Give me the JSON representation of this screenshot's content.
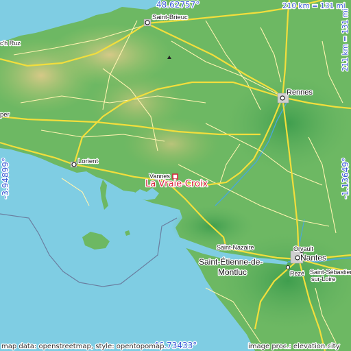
{
  "colors": {
    "sea": "#7fcde3",
    "land_low": "#5fb05f",
    "land_mid": "#9ac46b",
    "land_high": "#c8c27c",
    "road_major": "#f2de3c",
    "road_minor": "#fff4b0",
    "highlight": "#d8243c",
    "coord_text": "#3c5bd6"
  },
  "coords": {
    "north": "48.62757°",
    "south": "46.73433°",
    "west": "-3.94899°",
    "east": "-1.13649°"
  },
  "scale": {
    "horizontal": "210 km = 131 mi",
    "vertical": "211 km = 131 mi"
  },
  "marker": {
    "label": "La Vraie-Croix"
  },
  "places": {
    "saint_brieuc": "Saint-Brieuc",
    "c_h_ruz": "c'h Ruz",
    "rennes": "Rennes",
    "quimper": "per",
    "lorient": "Lorient",
    "vannes": "Vannes",
    "saint_nazaire": "Saint-Nazaire",
    "orvault": "Orvault",
    "nantes": "Nantes",
    "saint_etienne_1": "Saint-Étienne-de-",
    "saint_etienne_2": "Montluc",
    "reze": "Rezé",
    "saint_sebastien_1": "Saint-Sébastien-",
    "saint_sebastien_2": "sur-Loire"
  },
  "credits": {
    "left": "map data: openstreetmap, style: opentopomap",
    "right": "image proc.: elevation.city"
  }
}
